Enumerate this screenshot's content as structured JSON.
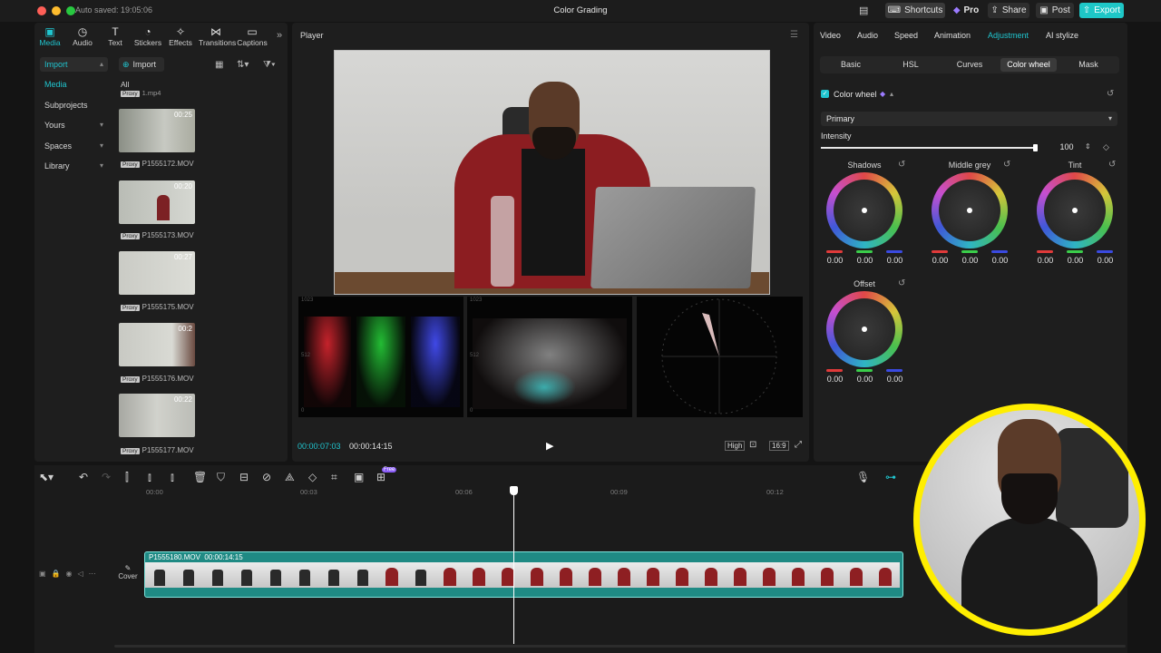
{
  "window": {
    "title": "Color Grading",
    "autosave": "Auto saved: 19:05:06"
  },
  "topbar": {
    "shortcuts": "Shortcuts",
    "pro": "Pro",
    "share": "Share",
    "post": "Post",
    "export": "Export"
  },
  "toolbar": [
    {
      "label": "Media",
      "icon": "media-icon",
      "active": true
    },
    {
      "label": "Audio",
      "icon": "audio-icon"
    },
    {
      "label": "Text",
      "icon": "text-icon"
    },
    {
      "label": "Stickers",
      "icon": "stickers-icon"
    },
    {
      "label": "Effects",
      "icon": "effects-icon"
    },
    {
      "label": "Transitions",
      "icon": "transitions-icon"
    },
    {
      "label": "Captions",
      "icon": "captions-icon"
    }
  ],
  "sidebar": {
    "items": [
      {
        "label": "Import"
      },
      {
        "label": "Media"
      },
      {
        "label": "Subprojects"
      },
      {
        "label": "Yours"
      },
      {
        "label": "Spaces"
      },
      {
        "label": "Library"
      }
    ]
  },
  "media": {
    "import_label": "Import",
    "all_label": "All",
    "first_name": "1.mp4",
    "proxy_tag": "Proxy",
    "clips": [
      {
        "duration": "00:25",
        "name": "P1555172.MOV"
      },
      {
        "duration": "00:20",
        "name": "P1555173.MOV"
      },
      {
        "duration": "00:27",
        "name": "P1555175.MOV"
      },
      {
        "duration": "00:2",
        "name": "P1555176.MOV"
      },
      {
        "duration": "00:22",
        "name": "P1555177.MOV"
      }
    ]
  },
  "player": {
    "title": "Player",
    "current_time": "00:00:07:03",
    "total_time": "00:00:14:15",
    "quality": "High",
    "ratio": "16:9",
    "waveform_labels": {
      "top": "1023",
      "mid": "512",
      "bottom": "0"
    }
  },
  "inspector": {
    "tabs": [
      {
        "label": "Video"
      },
      {
        "label": "Audio"
      },
      {
        "label": "Speed"
      },
      {
        "label": "Animation"
      },
      {
        "label": "Adjustment",
        "active": true
      },
      {
        "label": "AI stylize"
      }
    ],
    "subtabs": [
      {
        "label": "Basic"
      },
      {
        "label": "HSL"
      },
      {
        "label": "Curves"
      },
      {
        "label": "Color wheel",
        "active": true
      },
      {
        "label": "Mask"
      }
    ],
    "section_title": "Color wheel",
    "dropdown": "Primary",
    "intensity_label": "Intensity",
    "intensity_value": "100",
    "intensity_fraction": 1.0,
    "wheels": [
      {
        "label": "Shadows",
        "r": "0.00",
        "g": "0.00",
        "b": "0.00"
      },
      {
        "label": "Middle grey",
        "r": "0.00",
        "g": "0.00",
        "b": "0.00"
      },
      {
        "label": "Tint",
        "r": "0.00",
        "g": "0.00",
        "b": "0.00"
      },
      {
        "label": "Offset",
        "r": "0.00",
        "g": "0.00",
        "b": "0.00"
      }
    ]
  },
  "timeline": {
    "ruler": [
      "00:00",
      "00:03",
      "00:06",
      "00:09",
      "00:12"
    ],
    "clip_name": "P1555180.MOV",
    "clip_duration": "00:00:14:15",
    "cover_label": "Cover",
    "free_badge": "Free"
  },
  "colors": {
    "accent": "#20c5cf",
    "export": "#1ec7c7",
    "pro": "#7a5cff",
    "clip": "#1f8a84",
    "facecam_ring": "#ffee00"
  }
}
